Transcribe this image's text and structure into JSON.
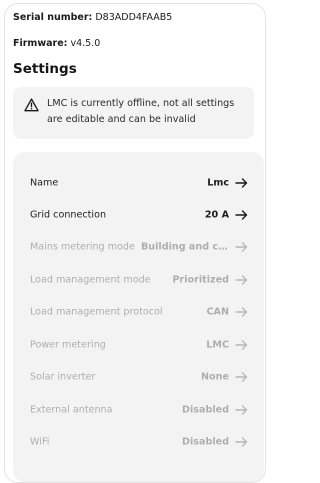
{
  "device": {
    "serial_label": "Serial number:",
    "serial_value": "D83ADD4FAAB5",
    "firmware_label": "Firmware:",
    "firmware_value": "v4.5.0"
  },
  "settings": {
    "title": "Settings",
    "notice": {
      "icon": "warning-icon",
      "text": "LMC is currently offline, not all settings are editable and can be invalid"
    },
    "rows": [
      {
        "label": "Name",
        "value": "Lmc",
        "enabled": true
      },
      {
        "label": "Grid connection",
        "value": "20 A",
        "enabled": true
      },
      {
        "label": "Mains metering mode",
        "value": "Building and c...",
        "enabled": false
      },
      {
        "label": "Load management mode",
        "value": "Prioritized",
        "enabled": false
      },
      {
        "label": "Load management protocol",
        "value": "CAN",
        "enabled": false
      },
      {
        "label": "Power metering",
        "value": "LMC",
        "enabled": false
      },
      {
        "label": "Solar inverter",
        "value": "None",
        "enabled": false
      },
      {
        "label": "External antenna",
        "value": "Disabled",
        "enabled": false
      },
      {
        "label": "WiFi",
        "value": "Disabled",
        "enabled": false
      }
    ],
    "row_icon": "arrow-right-icon"
  },
  "colors": {
    "enabled_text": "#1f1f1f",
    "disabled_text": "#aeaeae",
    "panel_background": "#f3f3f3"
  }
}
